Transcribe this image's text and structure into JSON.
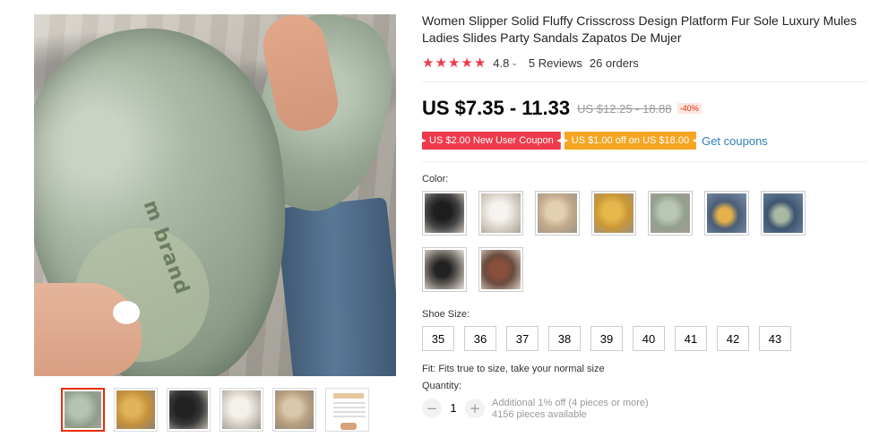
{
  "product": {
    "title": "Women Slipper Solid Fluffy Crisscross Design Platform Fur Sole Luxury Mules Ladies Slides Party Sandals Zapatos De Mujer",
    "rating": "4.8",
    "reviews": "5 Reviews",
    "orders": "26 orders",
    "price": "US $7.35 - 11.33",
    "price_original": "US $12.25 - 18.88",
    "discount": "-40%",
    "image_sole_text": "m brand"
  },
  "coupons": {
    "new_user": "US $2.00 New User Coupon",
    "store": "US $1.00 off on US $18.00",
    "get_link": "Get coupons"
  },
  "colors": {
    "star": "#f03a4b",
    "accent": "#e62e04",
    "coupon_red": "#f03a4b",
    "coupon_orange": "#f5a623",
    "link": "#2e7fb8"
  },
  "icons": {
    "star": "★",
    "caret": "⌄",
    "minus": "−",
    "plus": "+"
  },
  "gallery": {
    "thumbnails": [
      "green slipper",
      "yellow slipper",
      "black slipper",
      "white slipper",
      "khaki slipper",
      "size chart"
    ]
  },
  "options": {
    "color_label": "Color:",
    "color_swatches": [
      "black",
      "white",
      "khaki",
      "yellow",
      "green",
      "yellow-on-foot",
      "green-on-foot",
      "black-on-foot",
      "brown-on-foot"
    ],
    "size_label": "Shoe Size:",
    "sizes": [
      "35",
      "36",
      "37",
      "38",
      "39",
      "40",
      "41",
      "42",
      "43"
    ],
    "fit_note": "Fit: Fits true to size, take your normal size"
  },
  "quantity": {
    "label": "Quantity:",
    "value": "1",
    "discount_note": "Additional 1% off (4 pieces or more)",
    "available": "4156 pieces available"
  }
}
